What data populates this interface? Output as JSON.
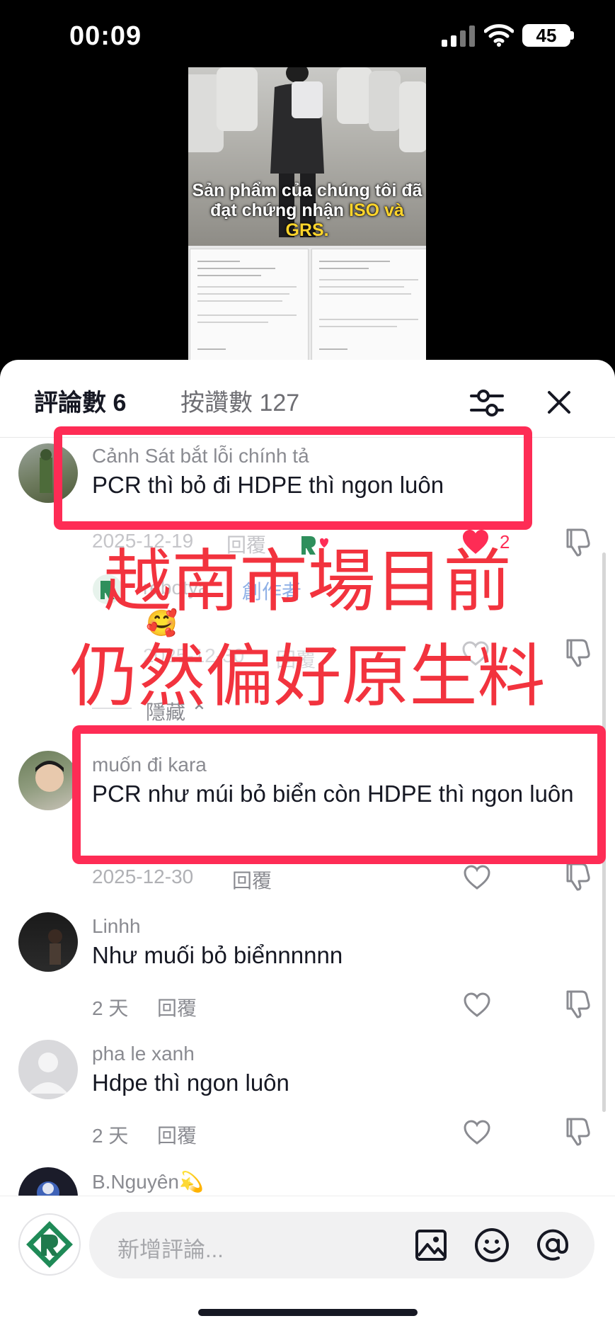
{
  "status_bar": {
    "time": "00:09",
    "battery": "45"
  },
  "video": {
    "caption_prefix": "Sản phẩm của chúng tôi đã đạt chứng nhận ",
    "caption_highlight": "ISO và GRS."
  },
  "header": {
    "comments_tab": "評論數 6",
    "likes_tab": "按讚數 127"
  },
  "comments": [
    {
      "user": "Cảnh Sát bắt lỗi chính tả",
      "text": "PCR thì bỏ đi HDPE thì ngon luôn",
      "date": "2025-12-19",
      "reply": "回覆",
      "likes": "2"
    },
    {
      "user": "muốn đi kara",
      "text": "PCR như múi bỏ biển còn HDPE thì ngon luôn",
      "date": "2025-12-30",
      "reply": "回覆"
    },
    {
      "user": "Linhh",
      "text": "Như muối bỏ biểnnnnnn",
      "date": "2 天",
      "reply": "回覆"
    },
    {
      "user": "pha le xanh",
      "text": "Hdpe thì ngon luôn",
      "date": "2 天",
      "reply": "回覆"
    },
    {
      "user": "B.Nguyên💫"
    }
  ],
  "reply_thread": {
    "user": "rebotya",
    "author_badge": "創作者",
    "date": "2025-12-30",
    "reply": "回覆",
    "hide_label": "隱藏"
  },
  "overlay": {
    "line1": "越南市場目前",
    "line2": "仍然偏好原生料",
    "color": "#f2333e"
  },
  "input": {
    "placeholder": "新增評論..."
  },
  "colors": {
    "highlight_box": "#fe2c55",
    "like": "#fe2c55"
  }
}
